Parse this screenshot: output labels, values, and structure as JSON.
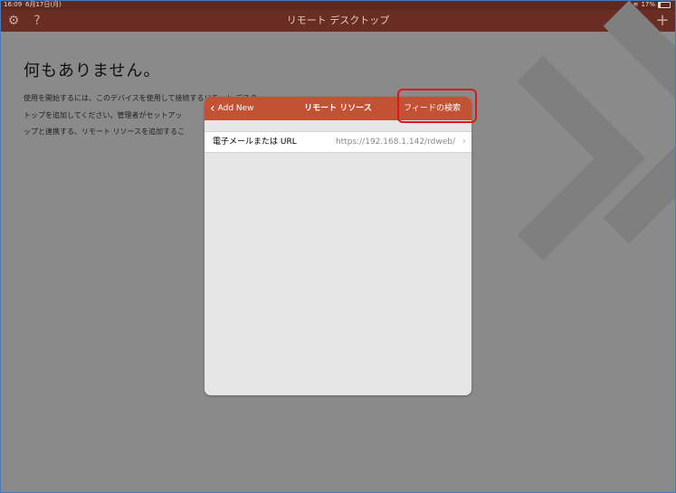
{
  "statusbar": {
    "time": "16:09",
    "date": "6月17日(月)",
    "battery": "17%"
  },
  "navbar": {
    "title": "リモート デスクトップ"
  },
  "background": {
    "heading": "何もありません。",
    "description": "使用を開始するには、このデバイスを使用して接続するリモート デスク\nトップを追加してください。管理者がセットアッ\nップと連携する、リモート リソースを追加するこ"
  },
  "modal": {
    "back_label": "Add New",
    "title": "リモート リソース",
    "feed_search_label": "フィードの検索",
    "field_label": "電子メールまたは URL",
    "field_value": "https://192.168.1.142/rdweb/"
  },
  "colors": {
    "accent": "#c35133",
    "highlight": "#e0161c"
  }
}
